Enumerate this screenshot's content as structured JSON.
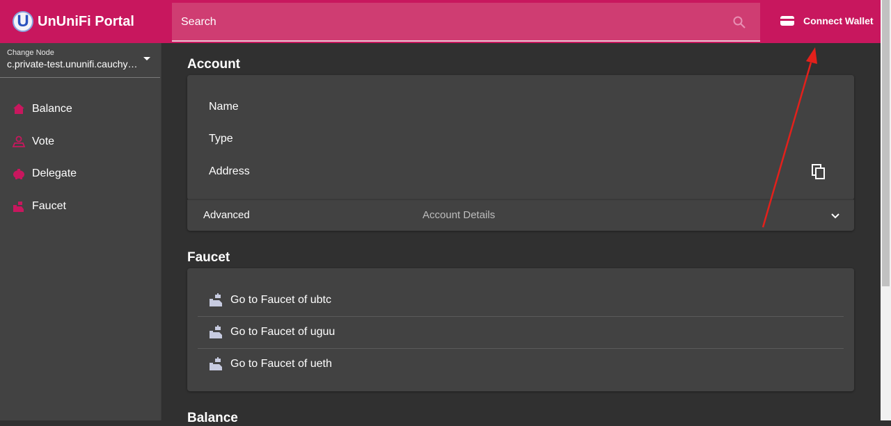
{
  "app": {
    "brand_letter": "U",
    "brand_name": "UnUniFi Portal",
    "accent_color": "#c8175e"
  },
  "node": {
    "label": "Change Node",
    "value": "c.private-test.ununifi.cauchye...."
  },
  "sidebar": {
    "items": [
      {
        "label": "Balance",
        "icon": "home-icon"
      },
      {
        "label": "Vote",
        "icon": "vote-icon"
      },
      {
        "label": "Delegate",
        "icon": "piggy-bank-icon"
      },
      {
        "label": "Faucet",
        "icon": "faucet-icon"
      }
    ]
  },
  "topbar": {
    "search_placeholder": "Search",
    "connect_wallet_label": "Connect Wallet"
  },
  "account": {
    "title": "Account",
    "rows": [
      "Name",
      "Type",
      "Address"
    ],
    "advanced": {
      "title": "Advanced",
      "description": "Account Details"
    }
  },
  "faucet": {
    "title": "Faucet",
    "items": [
      "Go to Faucet of ubtc",
      "Go to Faucet of uguu",
      "Go to Faucet of ueth"
    ]
  },
  "balance": {
    "title": "Balance"
  },
  "annotation": {
    "arrow_color": "#e3201b"
  }
}
